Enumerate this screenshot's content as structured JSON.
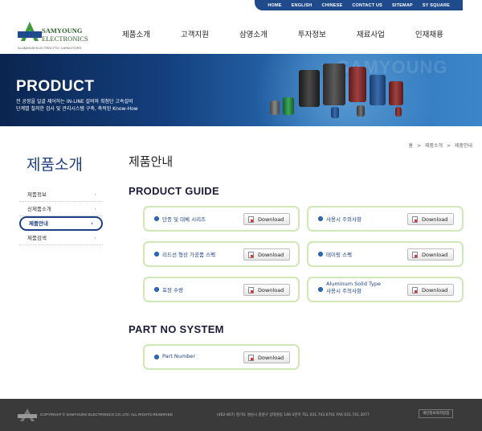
{
  "util_nav": [
    "HOME",
    "ENGLISH",
    "CHINESE",
    "CONTACT US",
    "SITEMAP",
    "SY SQUARE"
  ],
  "logo": {
    "brand_line1": "SAMYOUNG",
    "brand_line2": "ELECTRONICS",
    "tagline": "ALUMINUM ELECTROLYTIC CAPACITORS",
    "mark": "SAMYOUNG"
  },
  "gnb": [
    "제품소개",
    "고객지원",
    "삼영소개",
    "투자정보",
    "재료사업",
    "인재채용"
  ],
  "banner": {
    "title": "PRODUCT",
    "sub1": "전 공정을 일괄 제어하는 IN-LINE 설비와 최첨단 고속설비",
    "sub2": "단계별 철저한 검사 및 관리시스템 구축, 축적된 Know-How",
    "watermark": "SAMYOUNG"
  },
  "breadcrumb": [
    "홈",
    ">",
    "제품소개",
    ">",
    "제품안내"
  ],
  "sidebar": {
    "title": "제품소개",
    "items": [
      {
        "label": "제품정보",
        "active": false
      },
      {
        "label": "신제품소개",
        "active": false
      },
      {
        "label": "제품안내",
        "active": true
      },
      {
        "label": "제품검색",
        "active": false
      }
    ]
  },
  "main": {
    "page_title": "제품안내",
    "section1_title": "PRODUCT GUIDE",
    "section2_title": "PART NO SYSTEM",
    "download_label": "Download",
    "guide_cards": [
      {
        "label": "단종 및 대체 시리즈"
      },
      {
        "label": "사용시 주의사항"
      },
      {
        "label": "리드선 형상 가공품 스펙"
      },
      {
        "label": "테이핑 스펙"
      },
      {
        "label": "포장 수량"
      },
      {
        "label_line1": "Aluminum Solid Type",
        "label_line2": "사용시 주의사항"
      }
    ],
    "part_card": {
      "label": "Part Number"
    }
  },
  "footer": {
    "copyright": "COPYRIGHT © SAMYOUNG ELECTRONICS CO.,LTD. ALL RIGHTS RESERVED",
    "address": "(462-807) 경기도 성남시 중원구 상대원동 146-1번지    TEL  031.743.6701    FAX  031.741.3077",
    "policy": "개인정보처리방침"
  },
  "colors": {
    "navy": "#1d3f86",
    "util_bar": "#1f4a8c",
    "card_border": "#cfe8b6",
    "footer_bg": "#3a3a3a"
  }
}
